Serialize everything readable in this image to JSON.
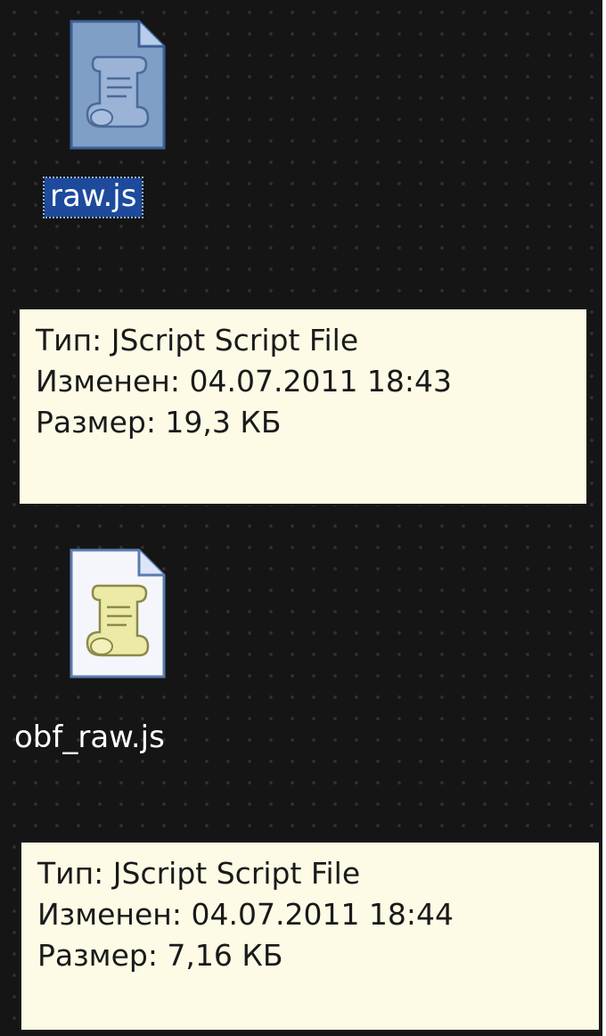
{
  "desktop": {
    "background_color": "#151515",
    "icons": [
      {
        "name": "raw.js",
        "selected": true,
        "icon": "jscript-file-icon",
        "icon_color": "#7fa0c8"
      },
      {
        "name": "obf_raw.js",
        "selected": false,
        "icon": "jscript-file-icon",
        "icon_color": "#e6e6a8"
      }
    ],
    "tooltips": [
      {
        "type": "Тип: JScript Script File",
        "modified": "Изменен: 04.07.2011 18:43",
        "size": "Размер: 19,3 КБ"
      },
      {
        "type": "Тип: JScript Script File",
        "modified": "Изменен: 04.07.2011 18:44",
        "size": "Размер: 7,16 КБ"
      }
    ]
  },
  "colors": {
    "selection": "#1d4a9c",
    "tooltip_bg": "#fdfbe6",
    "tooltip_border": "#1a1a1a",
    "label_text": "#ffffff"
  }
}
